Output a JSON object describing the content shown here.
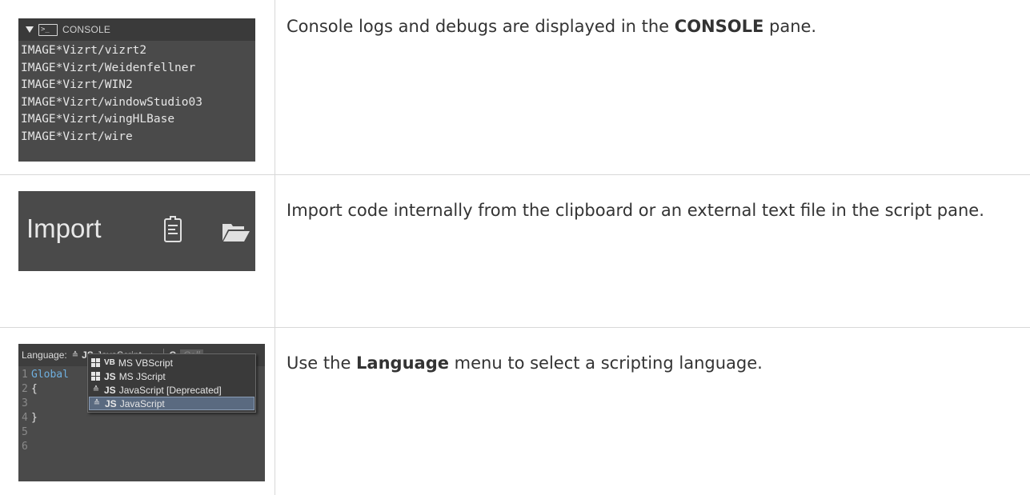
{
  "rows": [
    {
      "description_pre": "Console logs and debugs are displayed in the ",
      "description_bold": "CONSOLE",
      "description_post": " pane.",
      "console": {
        "title": "CONSOLE",
        "icon_glyph": ">_",
        "lines": [
          "IMAGE*Vizrt/vizrt2",
          "IMAGE*Vizrt/Weidenfellner",
          "IMAGE*Vizrt/WIN2",
          "IMAGE*Vizrt/windowStudio03",
          "IMAGE*Vizrt/wingHLBase",
          "IMAGE*Vizrt/wire"
        ]
      }
    },
    {
      "description": "Import code internally from the clipboard or an external text file in the script pane.",
      "import": {
        "label": "Import",
        "icons": [
          "clipboard-icon",
          "folder-icon"
        ]
      }
    },
    {
      "description_pre": "Use the ",
      "description_bold": "Language",
      "description_post": " menu to select a scripting language.",
      "language": {
        "label": "Language:",
        "selected_tag": "JS",
        "selected": "JavaScript",
        "select_arrow": "÷",
        "refresh_glyph": "C",
        "call_placeholder": "Call",
        "code": [
          {
            "num": "1",
            "kw": "Global",
            "txt": ""
          },
          {
            "num": "2",
            "kw": "",
            "txt": "{"
          },
          {
            "num": "3",
            "kw": "",
            "txt": ""
          },
          {
            "num": "4",
            "kw": "",
            "txt": "}"
          },
          {
            "num": "5",
            "kw": "",
            "txt": ""
          },
          {
            "num": "6",
            "kw": "",
            "txt": ""
          }
        ],
        "menu": [
          {
            "tag": "VB",
            "label": "MS VBScript",
            "icon": "windows-icon"
          },
          {
            "tag": "JS",
            "label": "MS JScript",
            "icon": "windows-icon"
          },
          {
            "tag": "JS",
            "label": "JavaScript [Deprecated]",
            "icon": "fox-icon"
          },
          {
            "tag": "JS",
            "label": "JavaScript",
            "icon": "fox-icon",
            "active": true
          }
        ]
      }
    }
  ]
}
